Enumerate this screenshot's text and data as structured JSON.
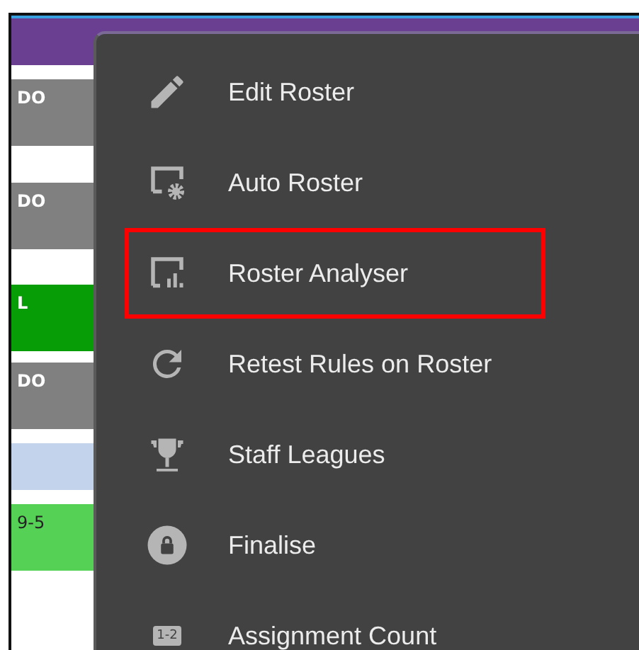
{
  "roster_cells": [
    {
      "text": "DO",
      "color": "#808080"
    },
    {
      "text": "DO",
      "color": "#808080"
    },
    {
      "text": "L",
      "color": "#079d07"
    },
    {
      "text": "DO",
      "color": "#808080"
    },
    {
      "color": "#c3d3ec"
    },
    {
      "text": "9-5",
      "color": "#55d155"
    }
  ],
  "menu": {
    "items": [
      {
        "kind": "pencil",
        "label": "Edit Roster",
        "highlighted": false
      },
      {
        "kind": "auto",
        "label": "Auto Roster",
        "highlighted": false
      },
      {
        "kind": "analyser",
        "label": "Roster Analyser",
        "highlighted": true
      },
      {
        "kind": "retest",
        "label": "Retest Rules on Roster",
        "highlighted": false
      },
      {
        "kind": "trophy",
        "label": "Staff Leagues",
        "highlighted": false
      },
      {
        "kind": "lock",
        "label": "Finalise",
        "highlighted": false
      },
      {
        "kind": "count",
        "label": "Assignment Count",
        "highlighted": false,
        "icon_text": "1-2"
      }
    ]
  }
}
